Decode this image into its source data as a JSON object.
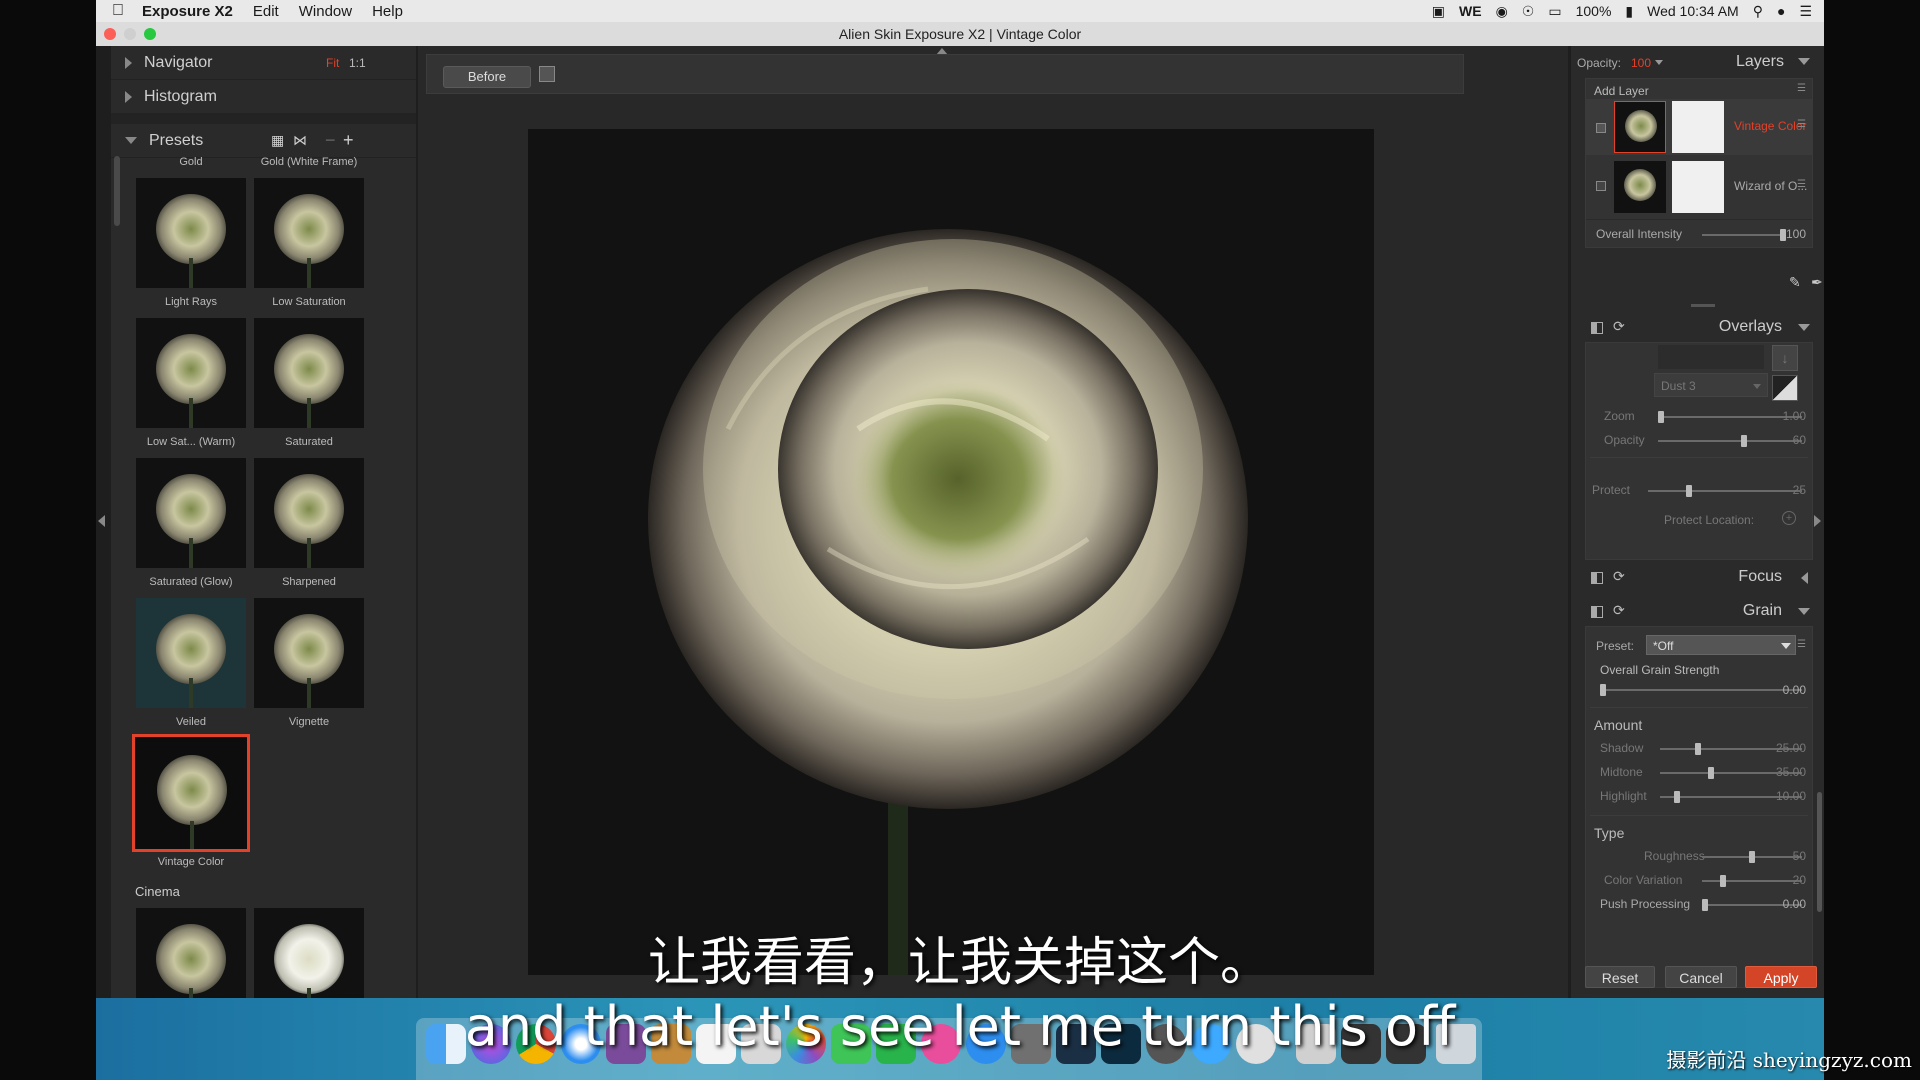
{
  "menubar": {
    "app_name": "Exposure X2",
    "items": [
      "Edit",
      "Window",
      "Help"
    ],
    "battery": "100%",
    "clock": "Wed 10:34 AM",
    "wechat": "WE"
  },
  "window": {
    "title": "Alien Skin Exposure X2 | Vintage Color"
  },
  "left": {
    "navigator": "Navigator",
    "nav_fit": "Fit",
    "nav_1to1": "1:1",
    "histogram": "Histogram",
    "presets": "Presets",
    "top_labels": [
      "Gold",
      "Gold (White Frame)"
    ],
    "thumbs": [
      "Light Rays",
      "Low Saturation",
      "Low Sat... (Warm)",
      "Saturated",
      "Saturated (Glow)",
      "Sharpened",
      "Veiled",
      "Vignette",
      "Vintage Color"
    ],
    "category": "Cinema"
  },
  "center": {
    "before_label": "Before"
  },
  "right": {
    "opacity_label": "Opacity:",
    "opacity_value": "100",
    "layers": "Layers",
    "add_layer": "Add Layer",
    "layer1": "Vintage Color",
    "layer2": "Wizard of O...",
    "overall_intensity": "Overall Intensity",
    "overall_intensity_value": "100",
    "overlays": "Overlays",
    "dust": "Dust 3",
    "zoom": "Zoom",
    "zoom_value": "1.00",
    "opacity2": "Opacity",
    "opacity2_value": "60",
    "protect": "Protect",
    "protect_value": "25",
    "protect_location": "Protect Location:",
    "focus": "Focus",
    "grain": "Grain",
    "preset_label": "Preset:",
    "preset_value": "*Off",
    "ogs": "Overall Grain Strength",
    "ogs_value": "0.00",
    "amount": "Amount",
    "shadow": "Shadow",
    "shadow_value": "25.00",
    "midtone": "Midtone",
    "midtone_value": "35.00",
    "highlight": "Highlight",
    "highlight_value": "10.00",
    "type": "Type",
    "roughness": "Roughness",
    "roughness_value": "50",
    "color_variation": "Color Variation",
    "color_variation_value": "20",
    "push_processing": "Push Processing",
    "push_processing_value": "0.00",
    "reset": "Reset",
    "cancel": "Cancel",
    "apply": "Apply"
  },
  "subtitles": {
    "cn": "让我看看，让我关掉这个。",
    "en": "and that let's see let me turn this off"
  },
  "watermark": "摄影前沿 sheyingzyz.com",
  "colors": {
    "accent": "#e2412a",
    "apply": "#d44426"
  }
}
